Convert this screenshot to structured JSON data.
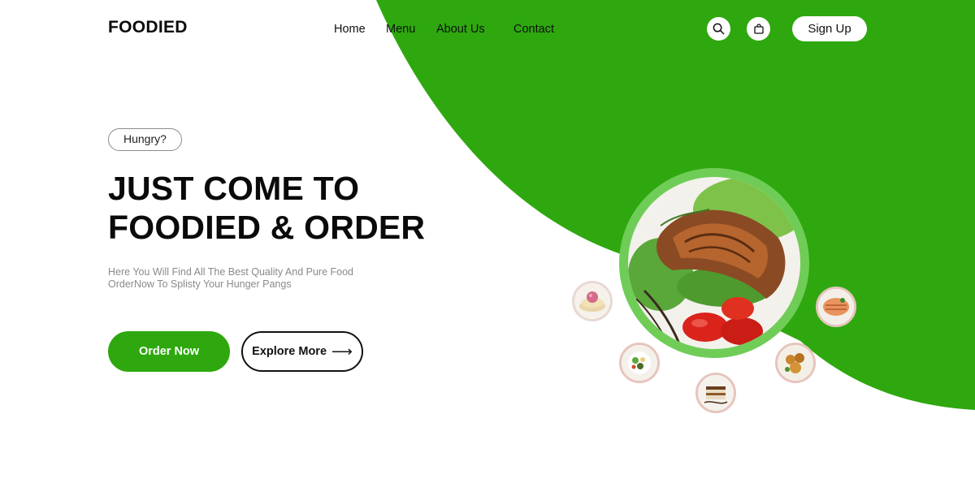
{
  "brand": {
    "name": "FOODIED"
  },
  "nav": {
    "items": [
      "Home",
      "Menu",
      "About Us",
      "Contact"
    ]
  },
  "header": {
    "signup_label": "Sign Up"
  },
  "hero": {
    "badge": "Hungry?",
    "headline_line1": "JUST COME TO",
    "headline_line2": "FOODIED & ORDER",
    "sub_line1": "Here You Will Find All The Best Quality And Pure Food",
    "sub_line2": "OrderNow To Splisty Your Hunger Pangs",
    "primary_cta": "Order Now",
    "secondary_cta": "Explore More",
    "secondary_cta_arrow": "⟶"
  },
  "colors": {
    "accent_green": "#2ea80e",
    "light_green_ring": "#6fcd57",
    "text_dark": "#0a0a0a",
    "text_muted": "#8a8a8a"
  },
  "icons": {
    "search": "search-icon",
    "cart": "shopping-bag-icon",
    "arrow": "arrow-right-icon"
  }
}
